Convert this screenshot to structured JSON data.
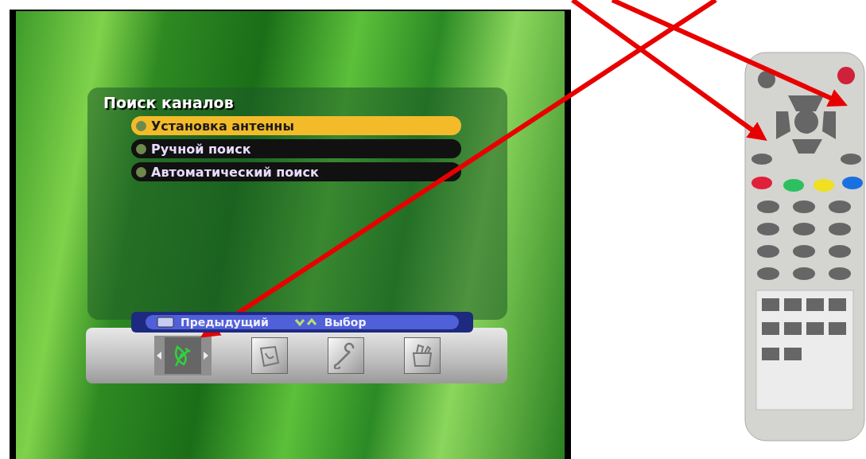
{
  "menu": {
    "title": "Поиск каналов",
    "items": [
      {
        "label": "Установка антенны",
        "selected": true
      },
      {
        "label": "Ручной поиск",
        "selected": false
      },
      {
        "label": "Автоматический поиск",
        "selected": false
      }
    ]
  },
  "hints": [
    {
      "kind": "exit",
      "label": "Предыдущий"
    },
    {
      "kind": "updown",
      "label": "Выбор"
    }
  ],
  "toolbar": [
    {
      "kind": "dish",
      "selected": true
    },
    {
      "kind": "media",
      "selected": false
    },
    {
      "kind": "tools",
      "selected": false
    },
    {
      "kind": "box",
      "selected": false
    }
  ]
}
